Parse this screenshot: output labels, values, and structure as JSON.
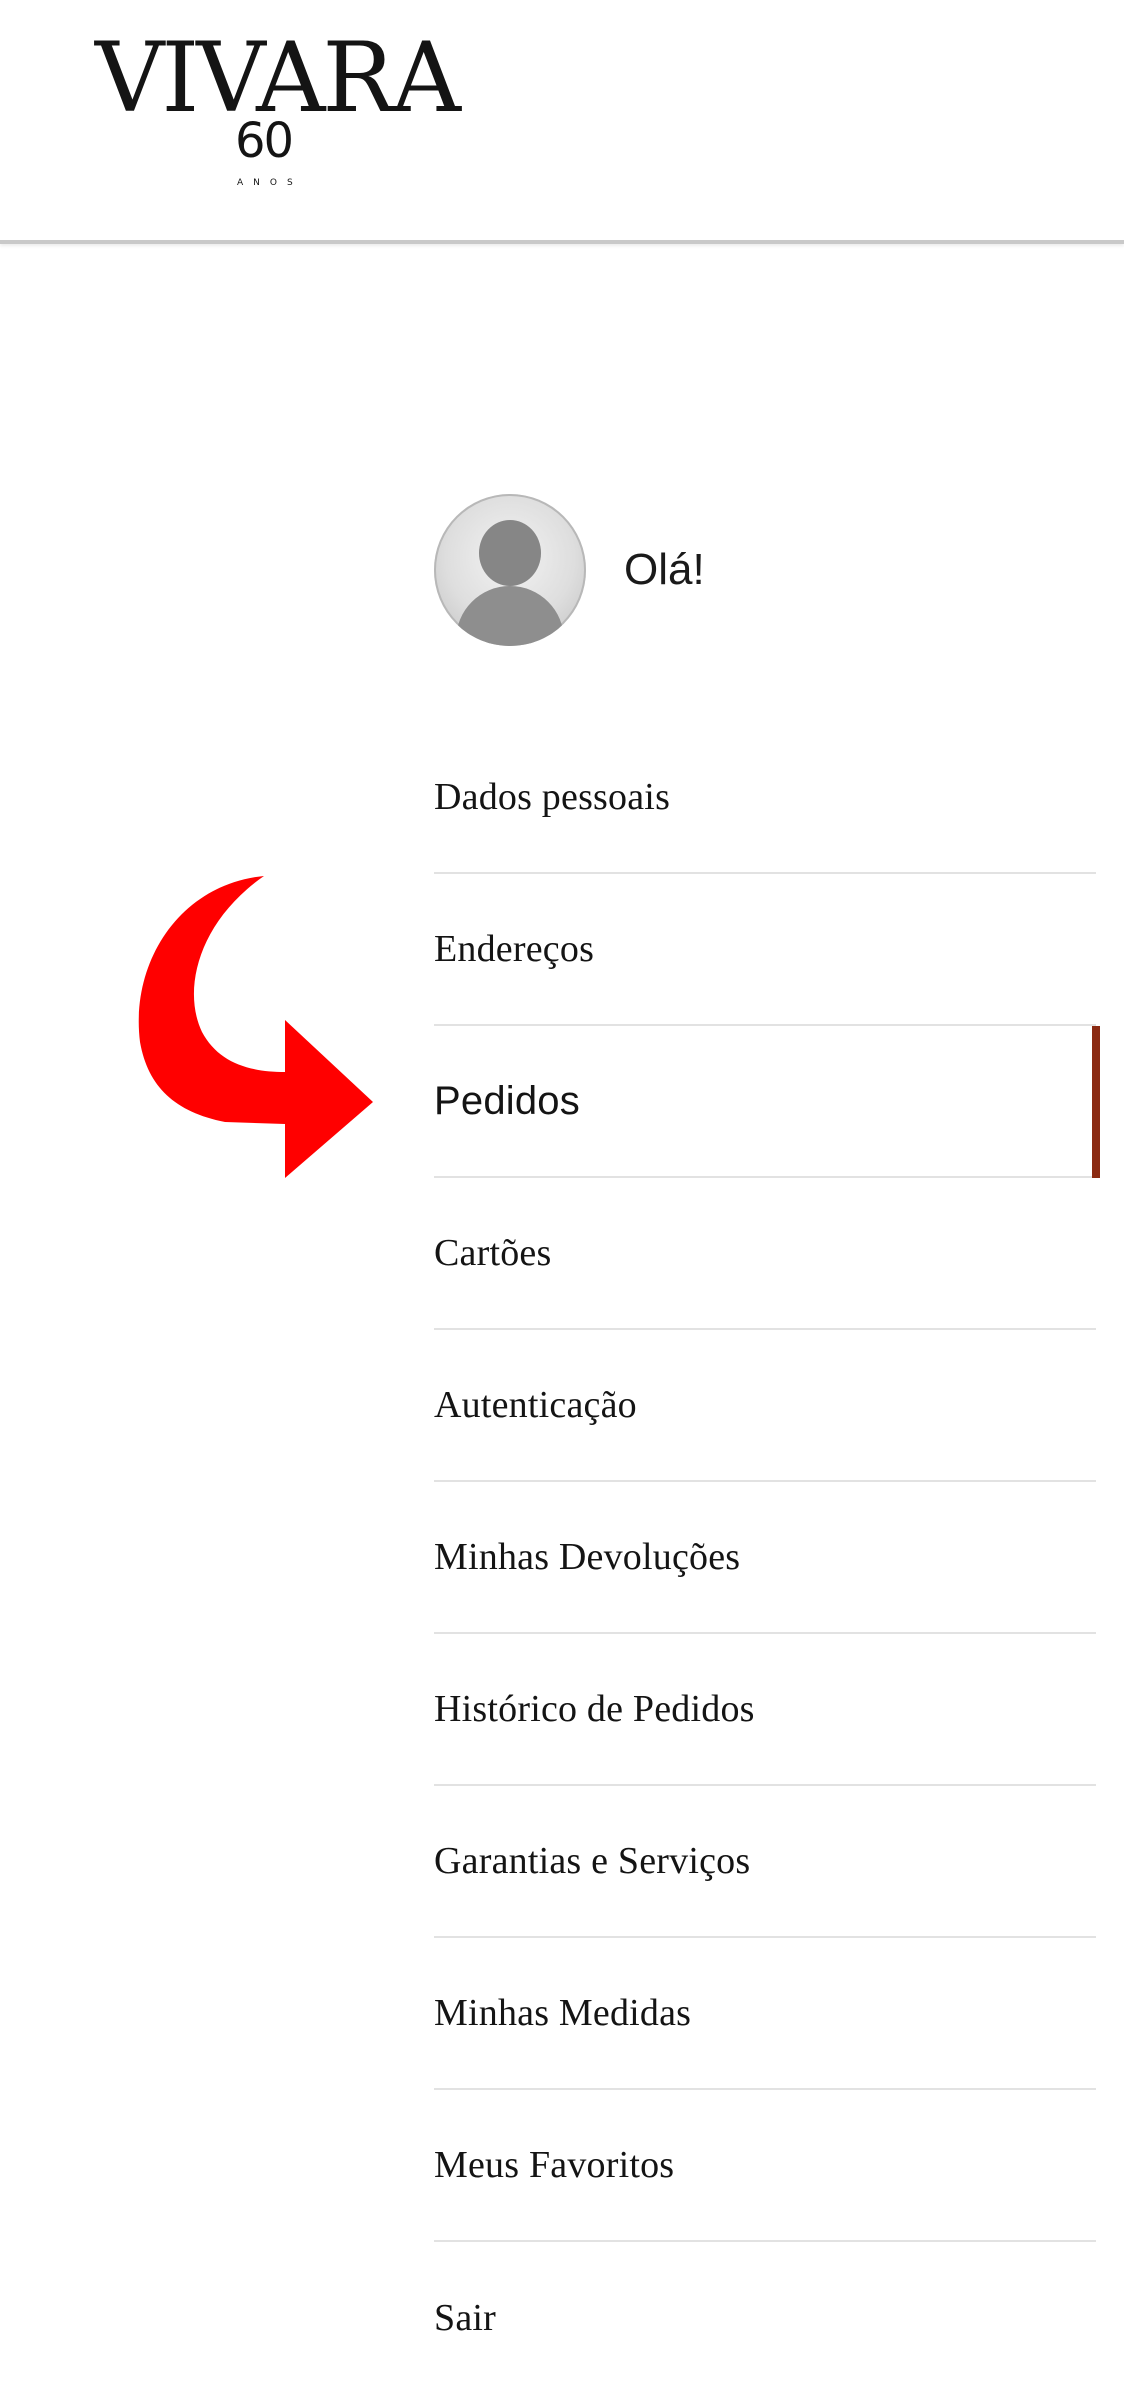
{
  "header": {
    "logo_word": "VIVARA",
    "logo_number": "60",
    "logo_sub": "ANOS"
  },
  "profile": {
    "greeting": "Olá!"
  },
  "menu": {
    "active_index": 2,
    "accent_color": "#8b2a12",
    "items": [
      {
        "label": "Dados pessoais"
      },
      {
        "label": "Endereços"
      },
      {
        "label": "Pedidos"
      },
      {
        "label": "Cartões"
      },
      {
        "label": "Autenticação"
      },
      {
        "label": "Minhas Devoluções"
      },
      {
        "label": "Histórico de Pedidos"
      },
      {
        "label": "Garantias e Serviços"
      },
      {
        "label": "Minhas Medidas"
      },
      {
        "label": "Meus Favoritos"
      },
      {
        "label": "Sair"
      }
    ]
  },
  "annotation": {
    "arrow_icon": "curved-arrow-right-icon",
    "arrow_color": "#ff0000"
  }
}
